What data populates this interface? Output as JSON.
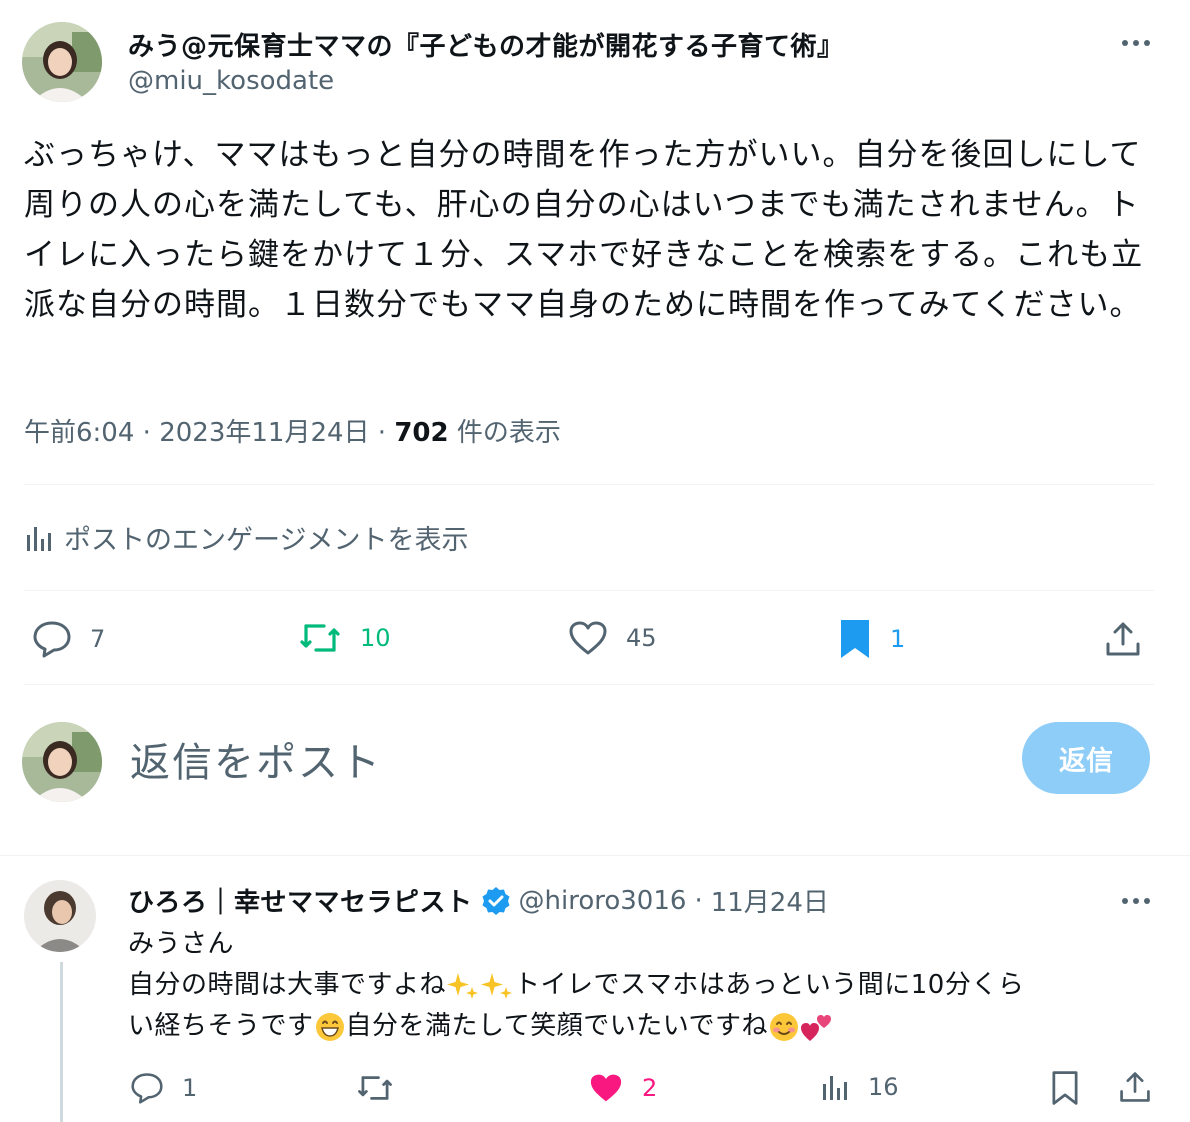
{
  "post": {
    "author_name": "みう@元保育士ママの『子どもの才能が開花する子育て術』",
    "author_handle": "@miu_kosodate",
    "body": "ぶっちゃけ、ママはもっと自分の時間を作った方がいい。自分を後回しにして周りの人の心を満たしても、肝心の自分の心はいつまでも満たされません。トイレに入ったら鍵をかけて１分、スマホで好きなことを検索をする。これも立派な自分の時間。１日数分でもママ自身のために時間を作ってみてください。",
    "time": "午前6:04",
    "date": "2023年11月24日",
    "views_count": "702",
    "views_label": "件の表示",
    "engagement_link": "ポストのエンゲージメントを表示",
    "actions": {
      "replies": "7",
      "reposts": "10",
      "likes": "45",
      "bookmarks": "1"
    }
  },
  "composer": {
    "placeholder": "返信をポスト",
    "button": "返信"
  },
  "reply": {
    "author_name": "ひろろ｜幸せママセラピスト",
    "author_handle": "@hiroro3016",
    "date": "11月24日",
    "line1": "みうさん",
    "line2a": "自分の時間は大事ですよね",
    "line2b": "トイレでスマホはあっという間に10分くら",
    "line3a": "い経ちそうです",
    "line3b": "自分を満たして笑顔でいたいですね",
    "actions": {
      "replies": "1",
      "likes": "2",
      "views": "16"
    }
  },
  "icons": [
    "more-icon",
    "chart-icon",
    "comment-icon",
    "repost-icon",
    "heart-icon",
    "bookmark-icon",
    "share-icon",
    "verified-icon",
    "sparkles-emoji",
    "grin-emoji",
    "smile-emoji",
    "hearts-emoji"
  ],
  "colors": {
    "text": "#0f1419",
    "secondary": "#536471",
    "repost_green": "#00ba7c",
    "bookmark_blue": "#1d9bf0",
    "like_pink": "#f91880",
    "reply_button": "#8ecdf7"
  }
}
